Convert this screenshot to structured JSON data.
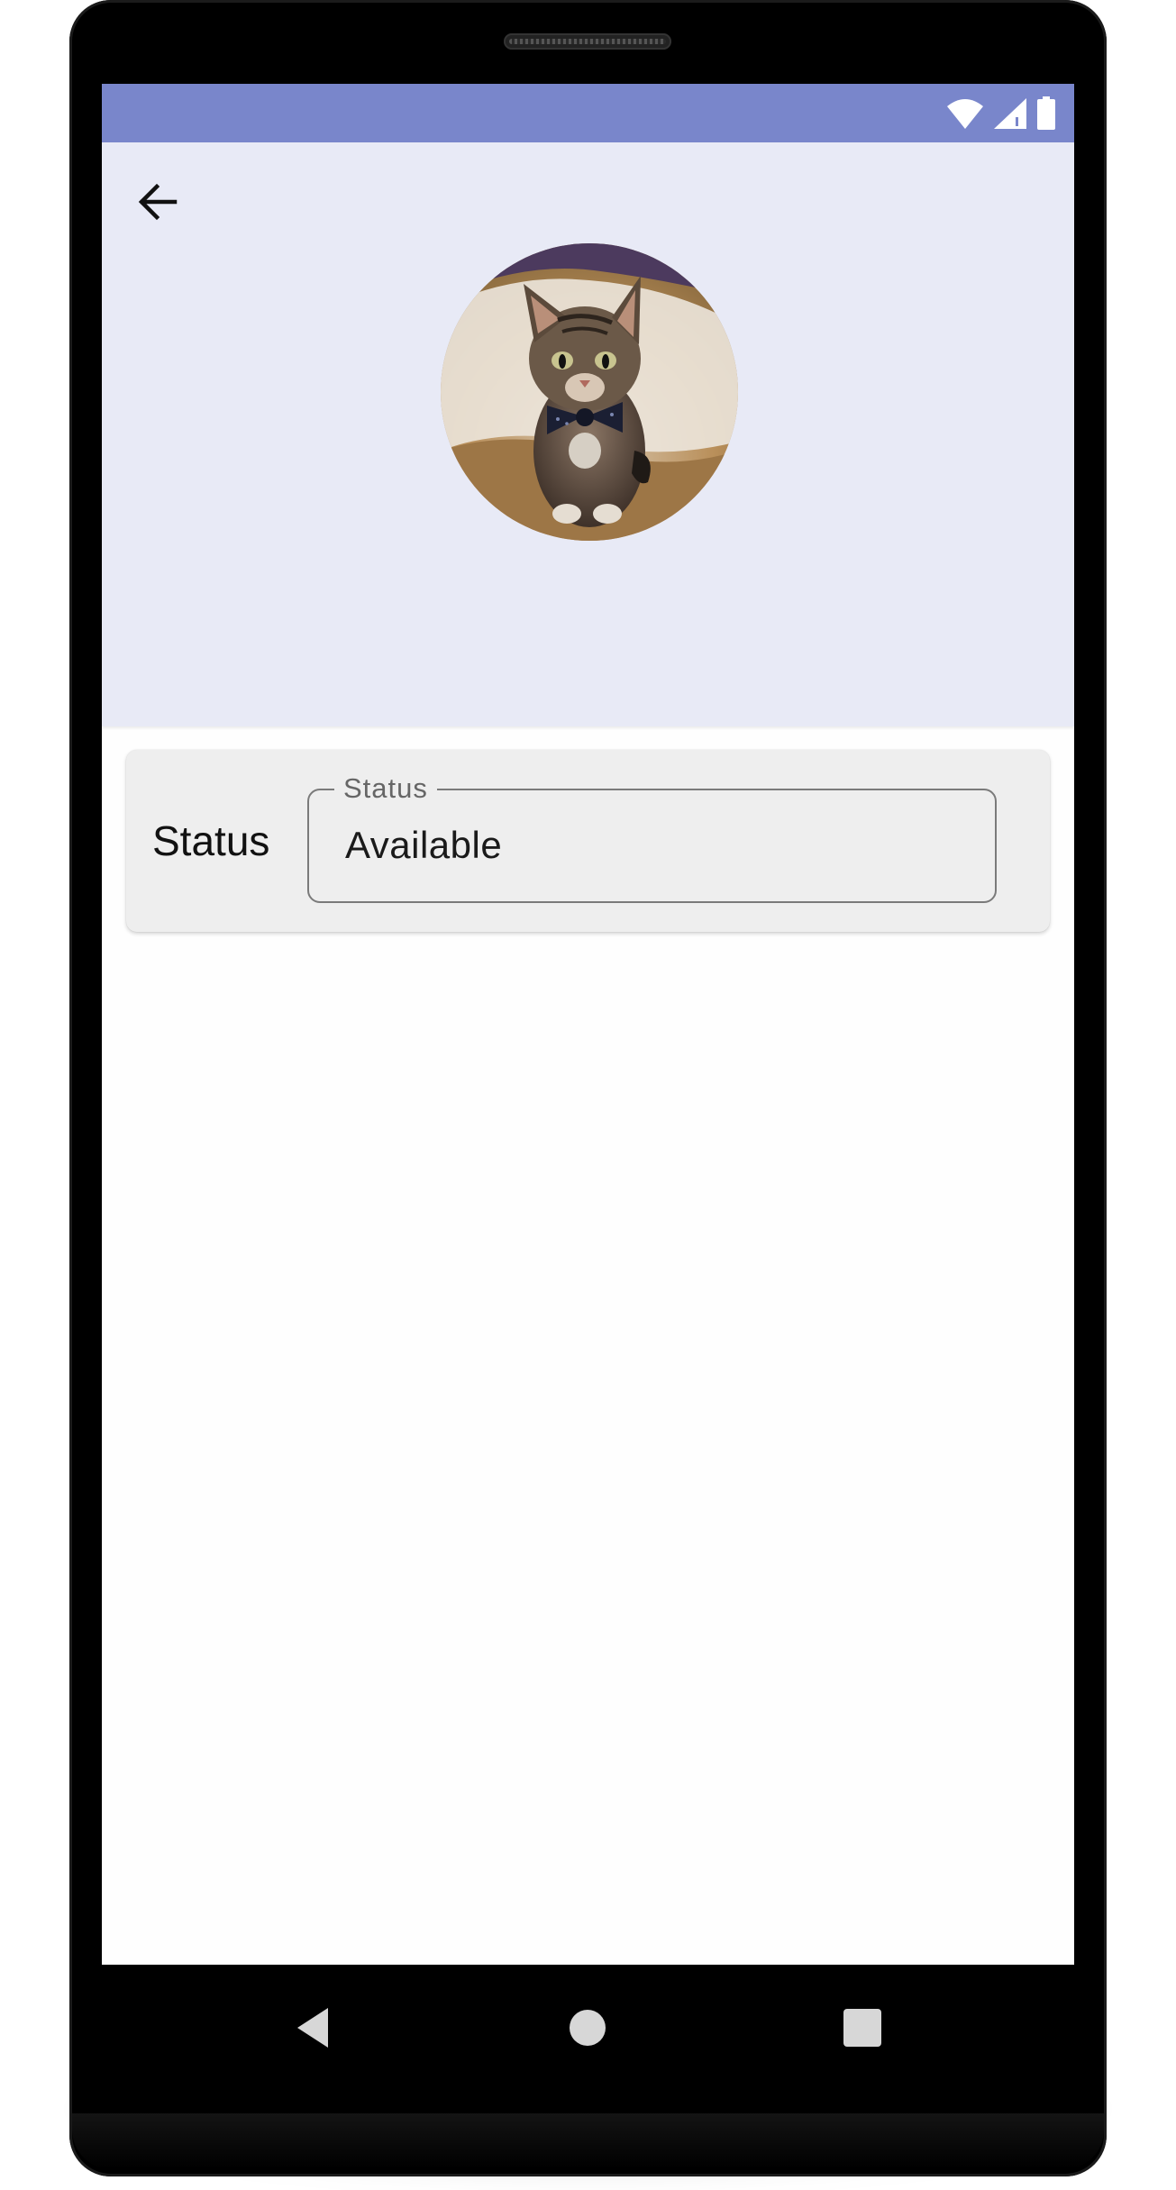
{
  "status_bar": {
    "background": "#7986cb",
    "icons": [
      "wifi-icon",
      "cell-signal-icon",
      "battery-icon"
    ]
  },
  "header": {
    "background": "#e8eaf6",
    "back_icon": "arrow-back-icon",
    "avatar": "kitten-with-bowtie-photo"
  },
  "status_card": {
    "label": "Status",
    "field": {
      "legend": "Status",
      "value": "Available"
    }
  },
  "nav_bar": {
    "icons": [
      "back-triangle-icon",
      "home-circle-icon",
      "recents-square-icon"
    ]
  }
}
